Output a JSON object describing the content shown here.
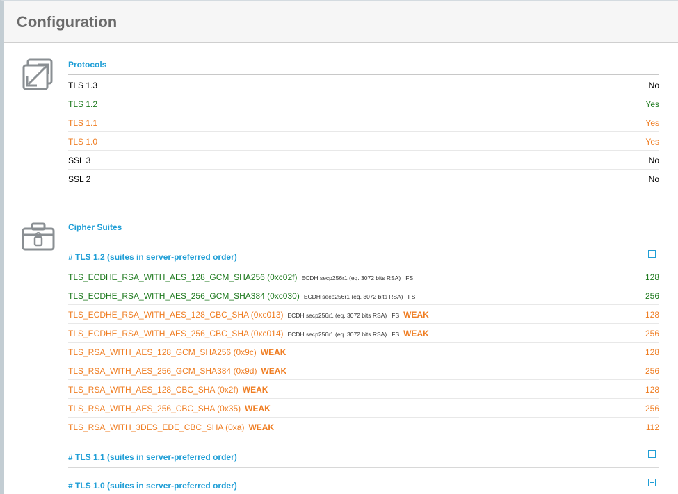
{
  "header": {
    "title": "Configuration"
  },
  "protocols": {
    "title": "Protocols",
    "rows": [
      {
        "name": "TLS 1.3",
        "value": "No",
        "status": "black"
      },
      {
        "name": "TLS 1.2",
        "value": "Yes",
        "status": "green"
      },
      {
        "name": "TLS 1.1",
        "value": "Yes",
        "status": "orange"
      },
      {
        "name": "TLS 1.0",
        "value": "Yes",
        "status": "orange"
      },
      {
        "name": "SSL 3",
        "value": "No",
        "status": "black"
      },
      {
        "name": "SSL 2",
        "value": "No",
        "status": "black"
      }
    ]
  },
  "ciphers": {
    "title": "Cipher Suites",
    "tls12_label": "# TLS 1.2 (suites in server-preferred order)",
    "tls11_label": "# TLS 1.1 (suites in server-preferred order)",
    "tls10_label": "# TLS 1.0 (suites in server-preferred order)",
    "rows": [
      {
        "name": "TLS_ECDHE_RSA_WITH_AES_128_GCM_SHA256",
        "hex": "(0xc02f)",
        "detail": "ECDH secp256r1 (eq. 3072 bits RSA)   FS",
        "weak": "",
        "bits": "128",
        "status": "green"
      },
      {
        "name": "TLS_ECDHE_RSA_WITH_AES_256_GCM_SHA384",
        "hex": "(0xc030)",
        "detail": "ECDH secp256r1 (eq. 3072 bits RSA)   FS",
        "weak": "",
        "bits": "256",
        "status": "green"
      },
      {
        "name": "TLS_ECDHE_RSA_WITH_AES_128_CBC_SHA",
        "hex": "(0xc013)",
        "detail": "ECDH secp256r1 (eq. 3072 bits RSA)   FS",
        "weak": "WEAK",
        "bits": "128",
        "status": "orange"
      },
      {
        "name": "TLS_ECDHE_RSA_WITH_AES_256_CBC_SHA",
        "hex": "(0xc014)",
        "detail": "ECDH secp256r1 (eq. 3072 bits RSA)   FS",
        "weak": "WEAK",
        "bits": "256",
        "status": "orange"
      },
      {
        "name": "TLS_RSA_WITH_AES_128_GCM_SHA256",
        "hex": "(0x9c)",
        "detail": "",
        "weak": "WEAK",
        "bits": "128",
        "status": "orange"
      },
      {
        "name": "TLS_RSA_WITH_AES_256_GCM_SHA384",
        "hex": "(0x9d)",
        "detail": "",
        "weak": "WEAK",
        "bits": "256",
        "status": "orange"
      },
      {
        "name": "TLS_RSA_WITH_AES_128_CBC_SHA",
        "hex": "(0x2f)",
        "detail": "",
        "weak": "WEAK",
        "bits": "128",
        "status": "orange"
      },
      {
        "name": "TLS_RSA_WITH_AES_256_CBC_SHA",
        "hex": "(0x35)",
        "detail": "",
        "weak": "WEAK",
        "bits": "256",
        "status": "orange"
      },
      {
        "name": "TLS_RSA_WITH_3DES_EDE_CBC_SHA",
        "hex": "(0xa)",
        "detail": "",
        "weak": "WEAK",
        "bits": "112",
        "status": "orange"
      }
    ]
  },
  "icons": {
    "protocols": "expand-arrows-icon",
    "ciphers": "briefcase-lock-icon",
    "collapse": "minus-box-icon",
    "expand": "plus-box-icon"
  },
  "colors": {
    "accent": "#1f9ed6",
    "ok": "#1f7a1f",
    "warn": "#ef7d22"
  }
}
